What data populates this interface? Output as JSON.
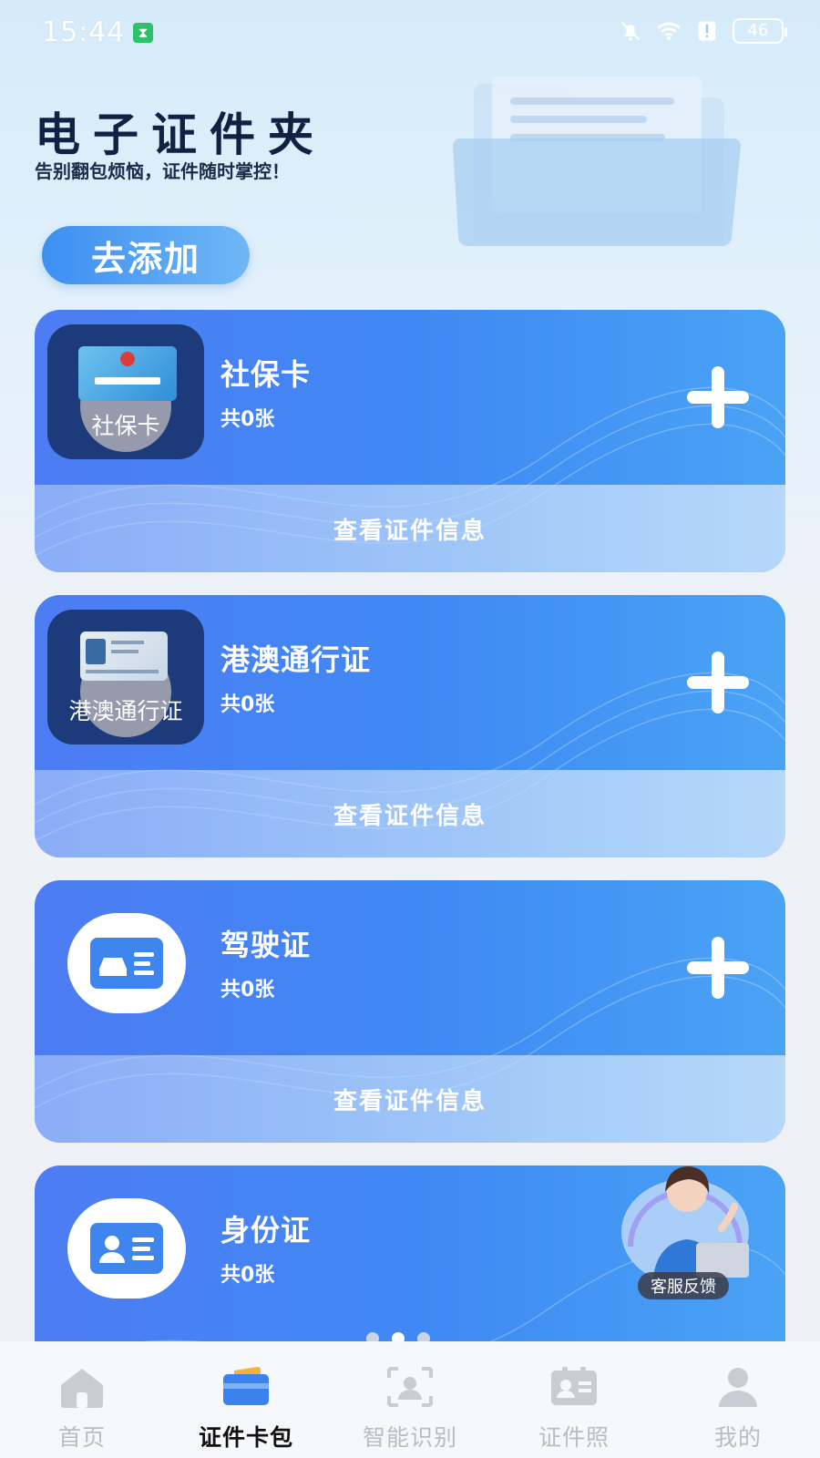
{
  "status_bar": {
    "time": "15:44",
    "battery": "46"
  },
  "header": {
    "title": "电子证件夹",
    "subtitle": "告别翻包烦恼，证件随时掌控！",
    "add_button": "去添加"
  },
  "cards": [
    {
      "name": "社保卡",
      "count": "共0张",
      "thumb_label": "社保卡",
      "view_label": "查看证件信息"
    },
    {
      "name": "港澳通行证",
      "count": "共0张",
      "thumb_label": "港澳通行证",
      "view_label": "查看证件信息"
    },
    {
      "name": "驾驶证",
      "count": "共0张",
      "icon": "car-card-icon",
      "view_label": "查看证件信息"
    },
    {
      "name": "身份证",
      "count": "共0张",
      "icon": "person-card-icon"
    }
  ],
  "customer_service": {
    "label": "客服反馈"
  },
  "tabbar": {
    "items": [
      {
        "label": "首页",
        "icon": "home-icon"
      },
      {
        "label": "证件卡包",
        "icon": "wallet-icon"
      },
      {
        "label": "智能识别",
        "icon": "scan-person-icon"
      },
      {
        "label": "证件照",
        "icon": "id-photo-icon"
      },
      {
        "label": "我的",
        "icon": "profile-icon"
      }
    ],
    "active_index": 1
  },
  "colors": {
    "accent": "#3f8af4",
    "title": "#0f2244"
  }
}
